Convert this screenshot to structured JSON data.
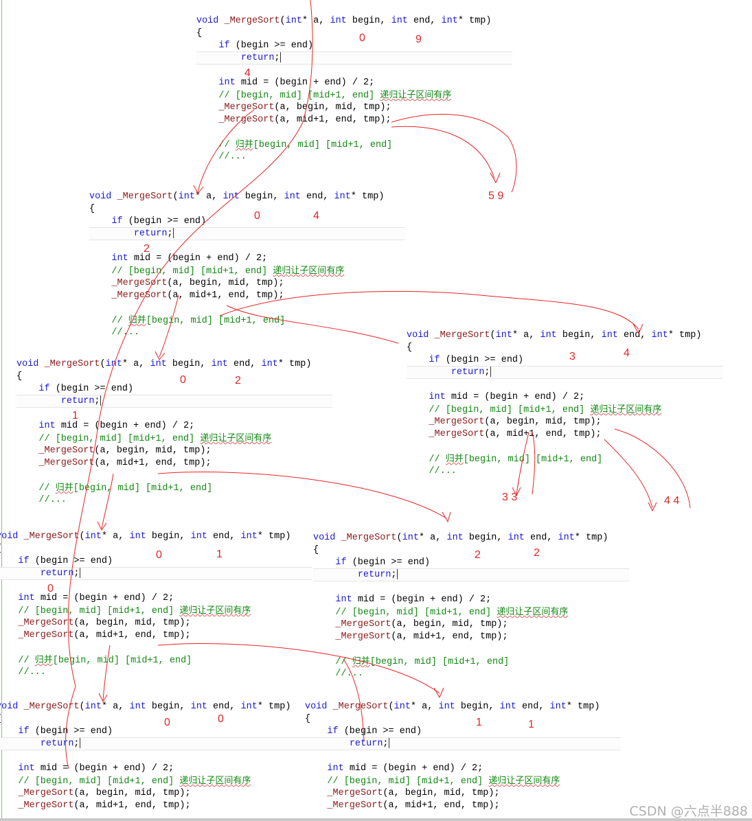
{
  "code_lines": [
    "void _MergeSort(int* a, int begin, int end, int* tmp)",
    "{",
    "    if (begin >= end)",
    "        return;",
    "",
    "    int mid = (begin + end) / 2;",
    "    // [begin, mid] [mid+1, end] 递归让子区间有序",
    "    _MergeSort(a, begin, mid, tmp);",
    "    _MergeSort(a, mid+1, end, tmp);",
    "",
    "    // 归并[begin, mid] [mid+1, end]",
    "    //..."
  ],
  "blocks": [
    {
      "id": "call-0-9",
      "begin": "0",
      "end": "9",
      "mid": "4"
    },
    {
      "id": "call-0-4",
      "begin": "0",
      "end": "4",
      "mid": "2"
    },
    {
      "id": "call-3-4",
      "begin": "3",
      "end": "4"
    },
    {
      "id": "call-0-2",
      "begin": "0",
      "end": "2",
      "mid": "1"
    },
    {
      "id": "call-0-1",
      "begin": "0",
      "end": "1",
      "mid": "0"
    },
    {
      "id": "call-2-2",
      "begin": "2",
      "end": "2"
    },
    {
      "id": "call-0-0",
      "begin": "0",
      "end": "0"
    },
    {
      "id": "call-1-1",
      "begin": "1",
      "end": "1"
    }
  ],
  "extra_annotations": {
    "right_half_0_9": "5 9",
    "left_3_3": "3 3",
    "right_4_4": "4 4"
  },
  "colors": {
    "annotation": "#e52424",
    "keyword": "#1a1ad6",
    "function": "#8b1a1a",
    "comment": "#118811"
  },
  "watermark": "CSDN @六点半888"
}
